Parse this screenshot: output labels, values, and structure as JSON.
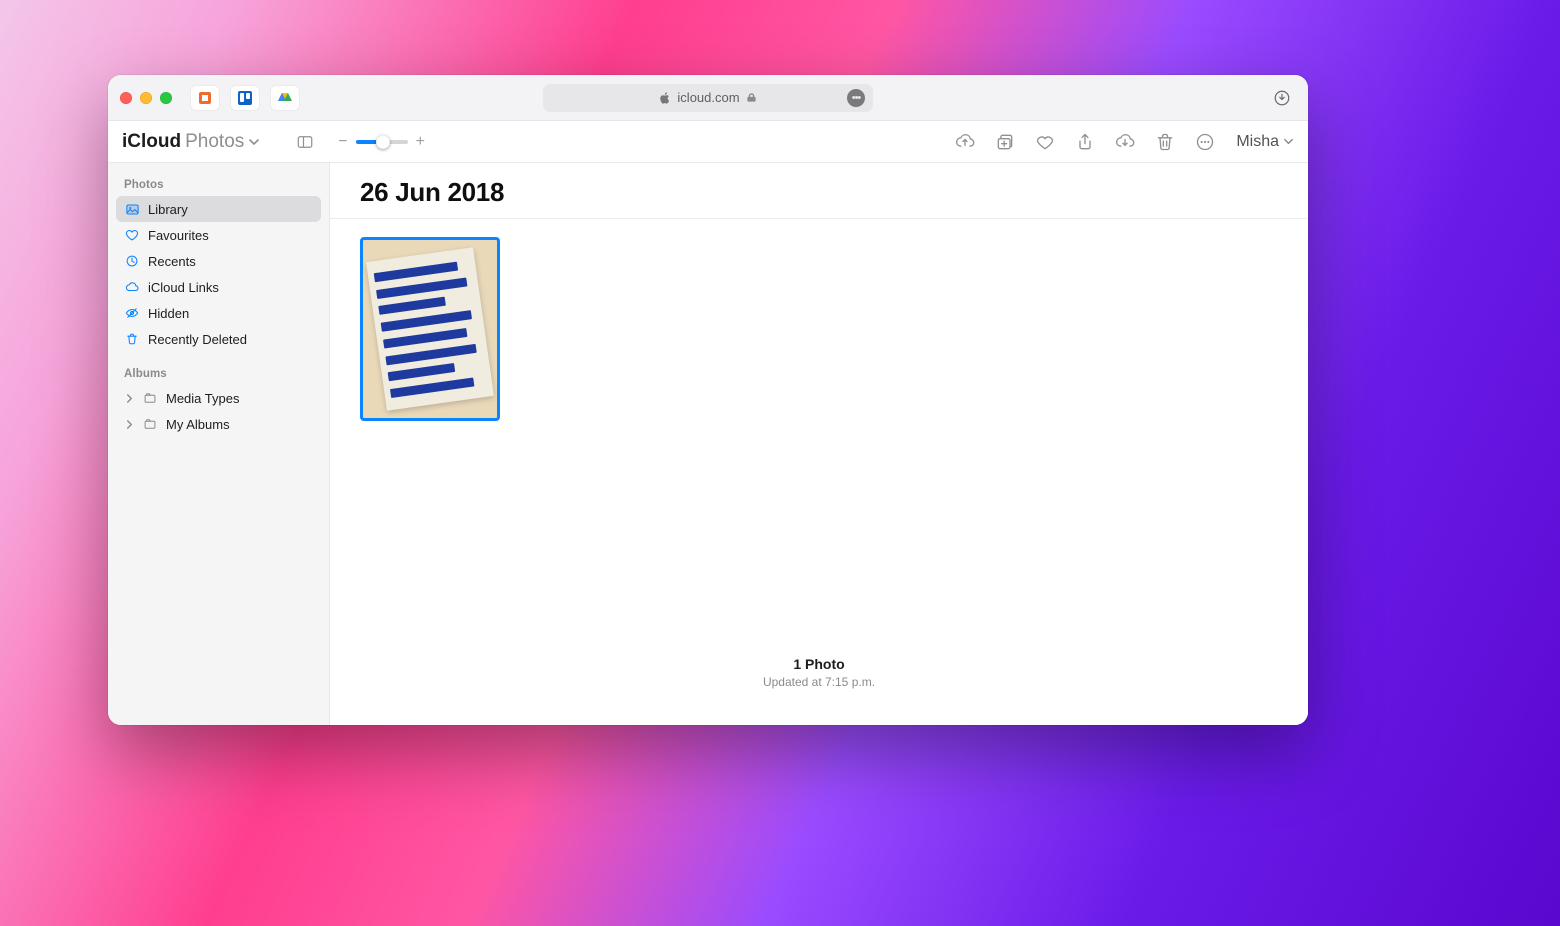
{
  "browser": {
    "url_host": "icloud.com"
  },
  "app": {
    "title_main": "iCloud",
    "title_sub": "Photos"
  },
  "user": {
    "name": "Misha"
  },
  "sidebar": {
    "section_photos": "Photos",
    "items": [
      {
        "label": "Library"
      },
      {
        "label": "Favourites"
      },
      {
        "label": "Recents"
      },
      {
        "label": "iCloud Links"
      },
      {
        "label": "Hidden"
      },
      {
        "label": "Recently Deleted"
      }
    ],
    "section_albums": "Albums",
    "albums": [
      {
        "label": "Media Types"
      },
      {
        "label": "My Albums"
      }
    ]
  },
  "main": {
    "date_title": "26 Jun 2018",
    "count_text": "1 Photo",
    "updated_text": "Updated at 7:15 p.m."
  }
}
